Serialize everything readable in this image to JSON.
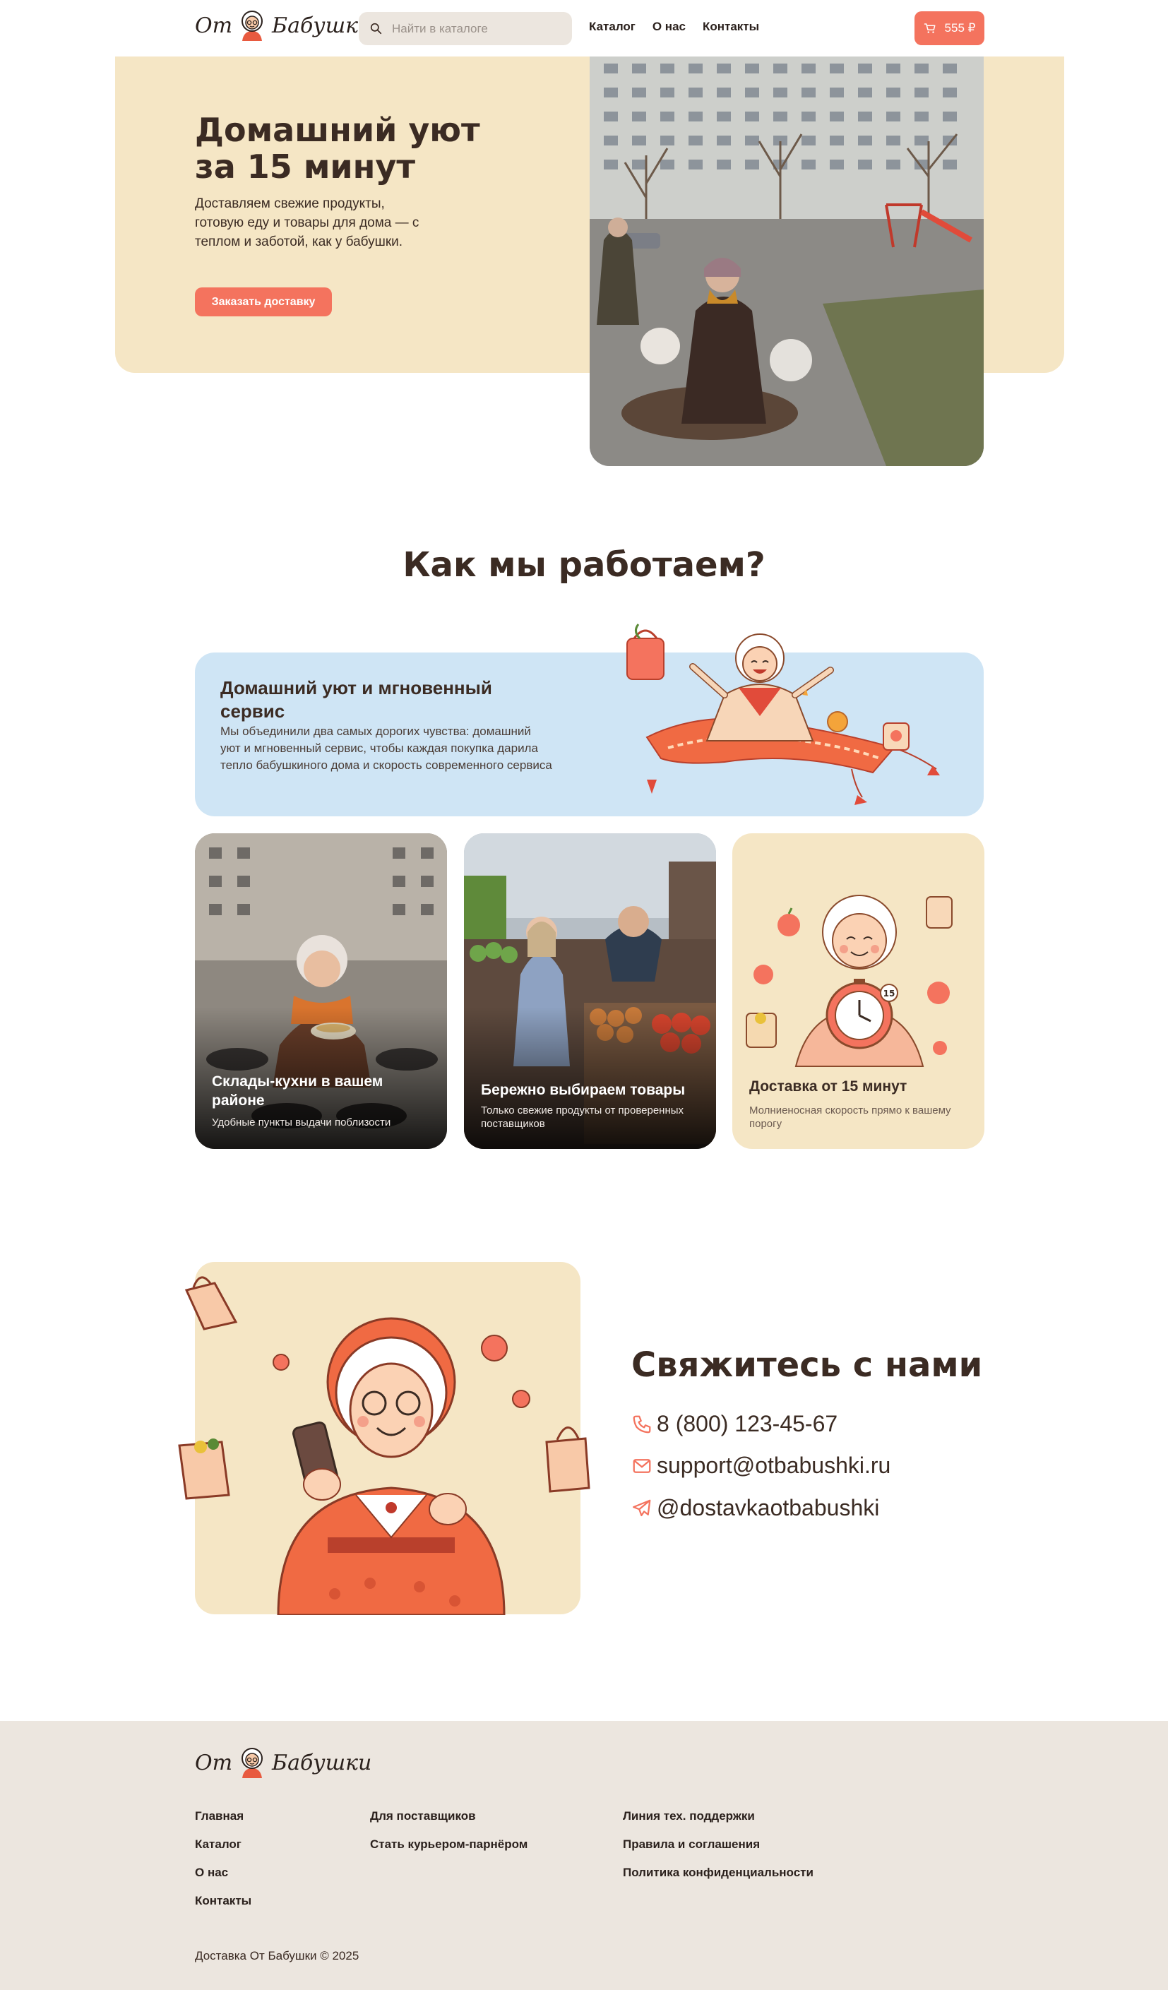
{
  "brand": {
    "word_left": "От",
    "word_right": "Бабушки"
  },
  "header": {
    "search_placeholder": "Найти в каталоге",
    "nav": [
      "Каталог",
      "О нас",
      "Контакты"
    ],
    "cart_total": "555 ₽"
  },
  "hero": {
    "title": "Домашний уют за 15 минут",
    "subtitle": "Доставляем свежие продукты, готовую еду и товары для дома — с теплом и заботой, как у бабушки.",
    "cta": "Заказать доставку"
  },
  "how": {
    "title": "Как мы работаем?",
    "card": {
      "title": "Домашний уют и мгновенный сервис",
      "text": "Мы объединили два самых дорогих чувства: домашний уют и мгновенный сервис, чтобы каждая покупка дарила тепло бабушкиного дома и скорость современного сервиса"
    },
    "tiles": [
      {
        "title": "Склады-кухни в вашем районе",
        "text": "Удобные пункты выдачи поблизости"
      },
      {
        "title": "Бережно выбираем товары",
        "text": "Только свежие продукты от проверенных поставщиков"
      },
      {
        "title": "Доставка от 15 минут",
        "text": "Молниеносная скорость прямо к вашему порогу",
        "timer_label": "15"
      }
    ]
  },
  "contacts": {
    "title": "Свяжитесь с нами",
    "phone": "8 (800) 123-45-67",
    "email": "support@otbabushki.ru",
    "telegram": "@dostavkaotbabushki"
  },
  "footer": {
    "col1": [
      "Главная",
      "Каталог",
      "О нас",
      "Контакты"
    ],
    "col2": [
      "Для поставщиков",
      "Стать курьером-парнёром"
    ],
    "col3": [
      "Линия тех. поддержки",
      "Правила и соглашения",
      "Политика конфиденциальности"
    ],
    "copyright": "Доставка От Бабушки © 2025"
  },
  "colors": {
    "accent": "#f4735e",
    "cream": "#f5e6c5",
    "sky": "#cfe5f5",
    "footer": "#ece6df",
    "text": "#3b2b23"
  }
}
